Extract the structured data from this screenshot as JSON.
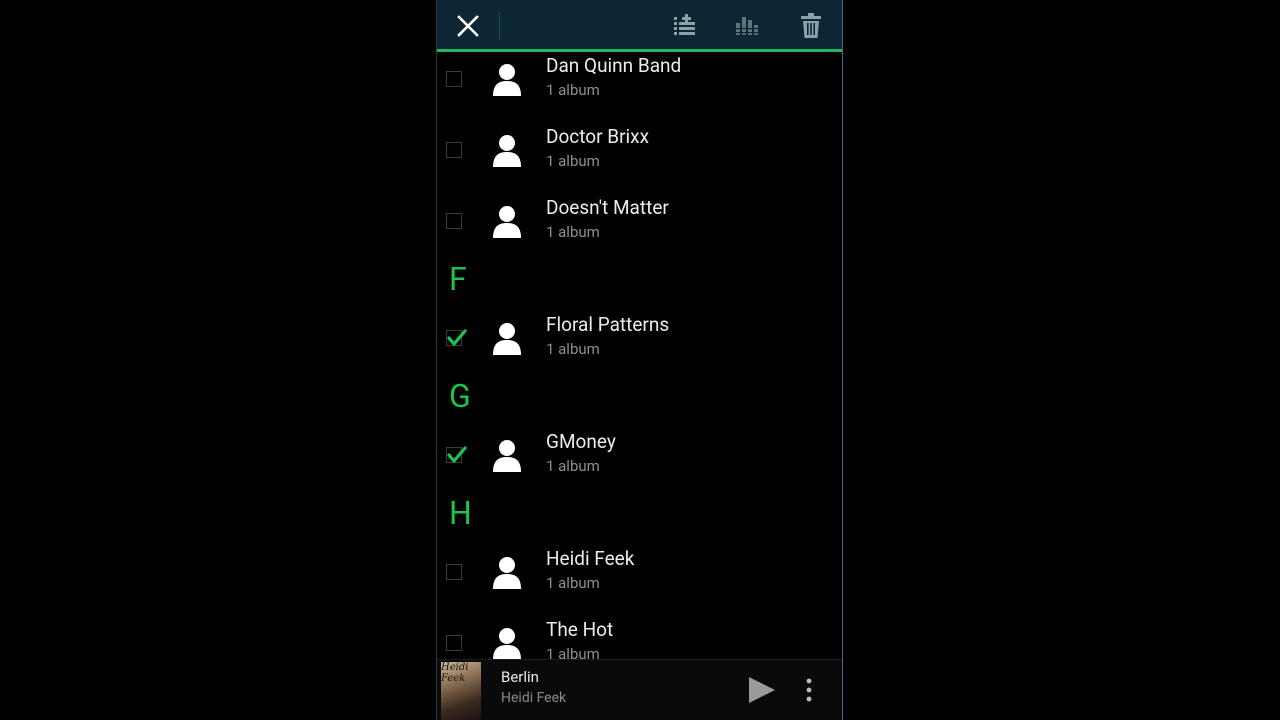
{
  "actionbar": {
    "close_icon": "close-icon",
    "actions": [
      {
        "name": "add-to-playlist-icon"
      },
      {
        "name": "equalizer-icon"
      },
      {
        "name": "delete-icon"
      }
    ],
    "accent": "#1fb75b",
    "background": "#0c2733"
  },
  "artists": [
    {
      "name": "Dan Quinn Band",
      "sub": "1 album",
      "checked": false
    },
    {
      "name": "Doctor Brixx",
      "sub": "1 album",
      "checked": false
    },
    {
      "name": "Doesn't Matter",
      "sub": "1 album",
      "checked": false
    },
    {
      "section": "F"
    },
    {
      "name": "Floral Patterns",
      "sub": "1 album",
      "checked": true
    },
    {
      "section": "G"
    },
    {
      "name": "GMoney",
      "sub": "1 album",
      "checked": true
    },
    {
      "section": "H"
    },
    {
      "name": "Heidi Feek",
      "sub": "1 album",
      "checked": false
    },
    {
      "name": "The Hot",
      "sub": "1 album",
      "checked": false
    }
  ],
  "now_playing": {
    "title": "Berlin",
    "artist": "Heidi Feek",
    "art_text": "Heidi Feek",
    "play_icon": "play-icon",
    "more_icon": "more-vert-icon"
  },
  "colors": {
    "section_letter": "#1fc24f",
    "check": "#1fc24f",
    "title_text": "#ececec",
    "sub_text": "#8e8e8e"
  }
}
